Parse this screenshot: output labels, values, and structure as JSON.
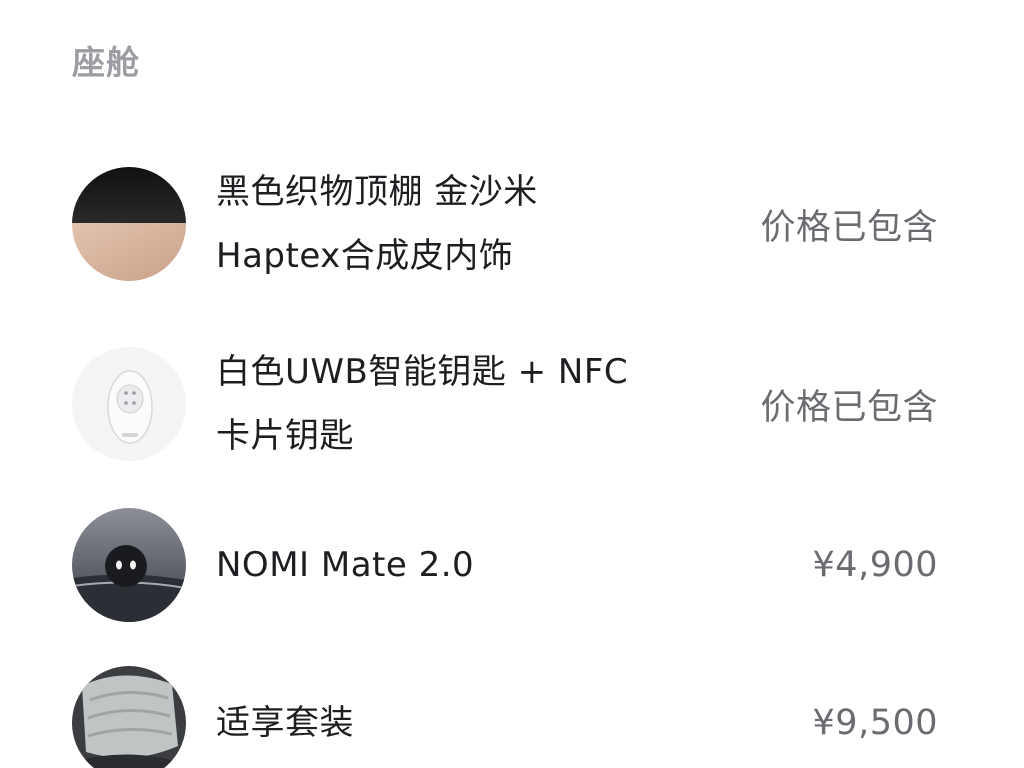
{
  "section": {
    "title": "座舱"
  },
  "items": [
    {
      "name_line1": "黑色织物顶棚 金沙米",
      "name_line2": "Haptex合成皮内饰",
      "price": "价格已包含",
      "thumb_icon": "headliner-interior-swatch"
    },
    {
      "name_line1": "白色UWB智能钥匙 + NFC",
      "name_line2": "卡片钥匙",
      "price": "价格已包含",
      "thumb_icon": "smart-key"
    },
    {
      "name_line1": "NOMI Mate 2.0",
      "name_line2": "",
      "price": "¥4,900",
      "thumb_icon": "nomi-robot"
    },
    {
      "name_line1": "适享套装",
      "name_line2": "",
      "price": "¥9,500",
      "thumb_icon": "car-seat"
    }
  ],
  "colors": {
    "section_title": "#9c9ca3",
    "item_text": "#1e1e22",
    "price_text": "#6b6b72",
    "background": "#ffffff"
  }
}
